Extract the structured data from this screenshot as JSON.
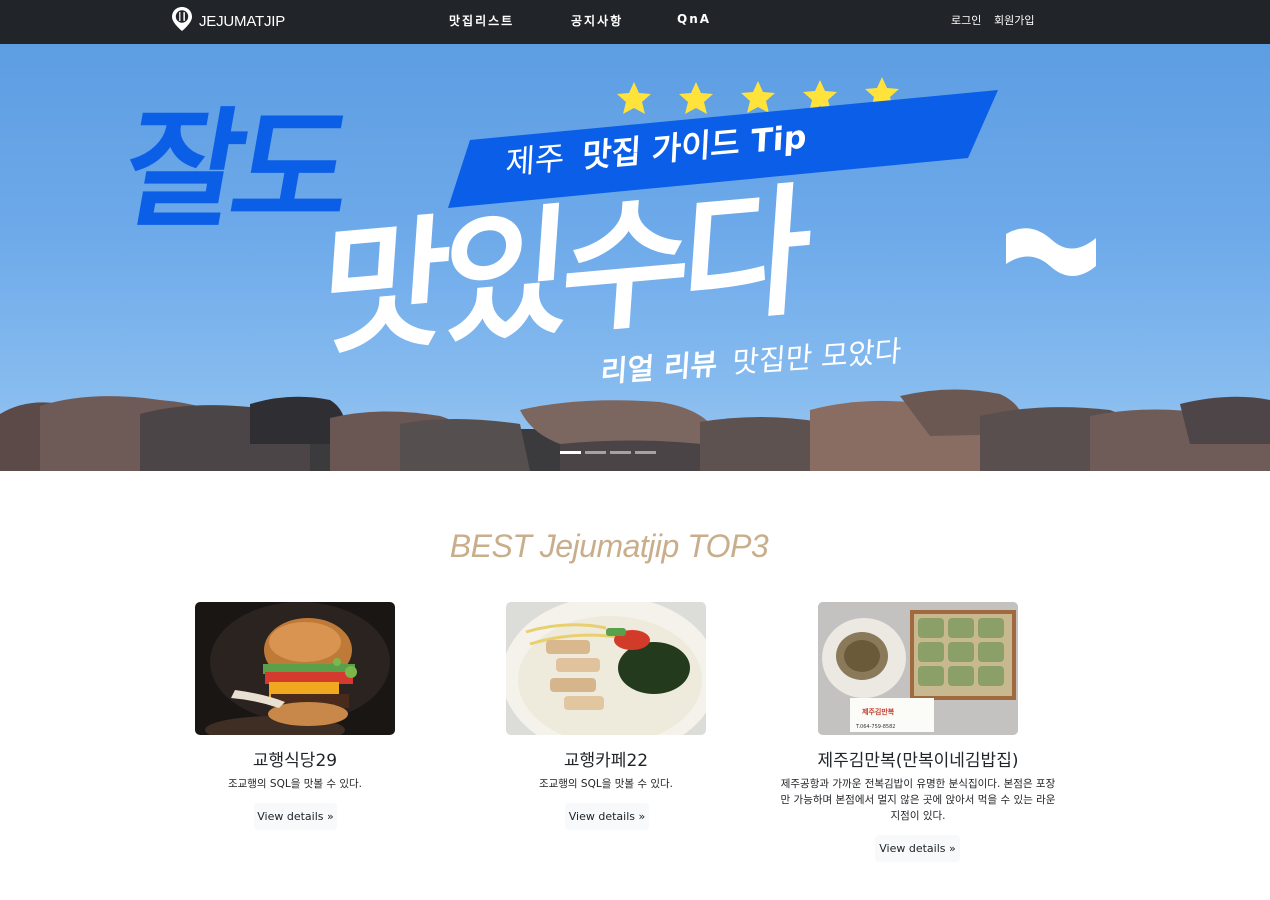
{
  "navbar": {
    "brand": "JEJUMATJIP",
    "links": [
      "맛집리스트",
      "공지사항",
      "QnA"
    ],
    "login": "로그인",
    "signup": "회원가입"
  },
  "hero": {
    "headline_top": "잘도",
    "headline_main": "맛있수다",
    "ribbon_light": "제주",
    "ribbon_bold": "맛집 가이드 Tip",
    "subline_bold": "리얼 리뷰",
    "subline_rest": "맛집만 모았다",
    "stars": 5,
    "slides": 4,
    "active_slide": 0
  },
  "section": {
    "title": "BEST Jejumatjip TOP3"
  },
  "cards": [
    {
      "name": "교행식당29",
      "desc": "조교행의 SQL을 맛볼 수 있다.",
      "button": "View details »",
      "image": "burger-photo"
    },
    {
      "name": "교행카페22",
      "desc": "조교행의 SQL을 맛볼 수 있다.",
      "button": "View details »",
      "image": "noodle-soup-photo"
    },
    {
      "name": "제주김만복(만복이네김밥집)",
      "desc": "제주공항과 가까운 전복김밥이 유명한 분식집이다. 본점은 포장만 가능하며 본점에서 멀지 않은 곳에 앉아서 먹을 수 있는 라운지점이 있다.",
      "button": "View details »",
      "image": "gimbap-photo",
      "label_card": "제주김만복",
      "label_phone": "T.064-759-8582"
    }
  ],
  "colors": {
    "navbar": "#212529",
    "section_title": "#c9ae8c",
    "hero_sky": "#6eaaea",
    "ribbon": "#0a5ee8"
  }
}
